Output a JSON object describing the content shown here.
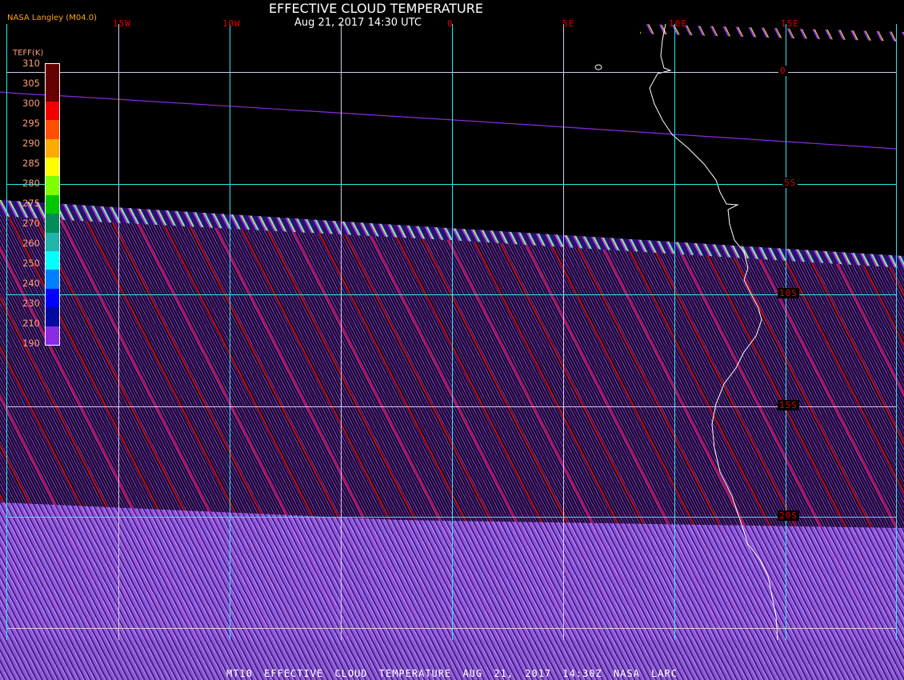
{
  "header": {
    "title": "EFFECTIVE CLOUD TEMPERATURE",
    "subtitle": "Aug 21, 2017 14:30 UTC",
    "credit": "NASA Langley (M04.0)"
  },
  "footer": {
    "text": "MT10  EFFECTIVE CLOUD TEMPERATURE  AUG 21, 2017 14:30Z  NASA LARC"
  },
  "map": {
    "longitude_labels": [
      "15W",
      "10W",
      "0",
      "5E",
      "10E",
      "15E"
    ],
    "latitude_labels": [
      "0",
      "5S",
      "10S",
      "15S",
      "20S"
    ]
  },
  "legend": {
    "title": "TEFF(K)",
    "ticks": [
      "310",
      "305",
      "300",
      "295",
      "290",
      "285",
      "280",
      "275",
      "270",
      "260",
      "250",
      "240",
      "230",
      "210",
      "190"
    ],
    "colors": [
      "#650000",
      "#650000",
      "#f00000",
      "#ff5000",
      "#ffaa00",
      "#ffff00",
      "#80ff00",
      "#00c800",
      "#008c5a",
      "#20b4aa",
      "#00ffff",
      "#0080ff",
      "#0000ff",
      "#000aa0",
      "#8a2be2"
    ]
  }
}
